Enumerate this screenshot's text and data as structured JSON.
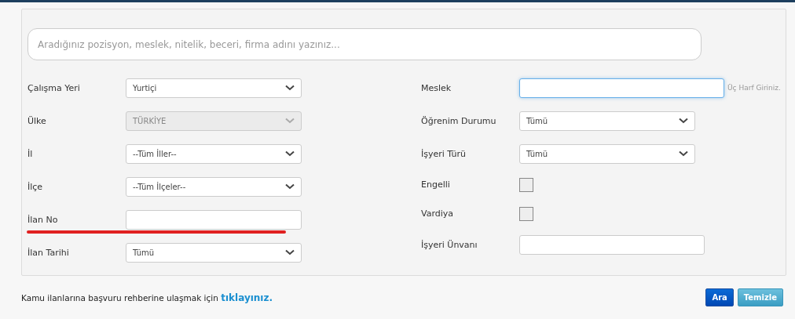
{
  "search": {
    "placeholder": "Aradığınız pozisyon, meslek, nitelik, beceri, firma adını yazınız..."
  },
  "left_fields": [
    {
      "label": "Çalışma Yeri",
      "kind": "select",
      "value": "Yurtiçi",
      "disabled": false
    },
    {
      "label": "Ülke",
      "kind": "select",
      "value": "TÜRKİYE",
      "disabled": true
    },
    {
      "label": "İl",
      "kind": "select",
      "value": "--Tüm İller--",
      "disabled": false
    },
    {
      "label": "İlçe",
      "kind": "select",
      "value": "--Tüm İlçeler--",
      "disabled": false
    },
    {
      "label": "İlan No",
      "kind": "input",
      "focused": false
    },
    {
      "label": "İlan Tarihi",
      "kind": "select",
      "value": "Tümü",
      "disabled": false
    }
  ],
  "right_fields": [
    {
      "label": "Meslek",
      "kind": "input",
      "focused": true,
      "hint": "Üç Harf Giriniz."
    },
    {
      "label": "Öğrenim Durumu",
      "kind": "select",
      "value": "Tümü",
      "disabled": false
    },
    {
      "label": "İşyeri Türü",
      "kind": "select",
      "value": "Tümü",
      "disabled": false
    },
    {
      "label": "Engelli",
      "kind": "checkbox",
      "checked": false
    },
    {
      "label": "Vardiya",
      "kind": "checkbox",
      "checked": false
    },
    {
      "label": "İşyeri Ünvanı",
      "kind": "input",
      "focused": false
    }
  ],
  "footer": {
    "text": "Kamu ilanlarına başvuru rehberine ulaşmak için",
    "link": "tıklayınız."
  },
  "buttons": [
    {
      "label": "Ara",
      "kind": "primary"
    },
    {
      "label": "Temizle",
      "kind": "secondary"
    }
  ]
}
